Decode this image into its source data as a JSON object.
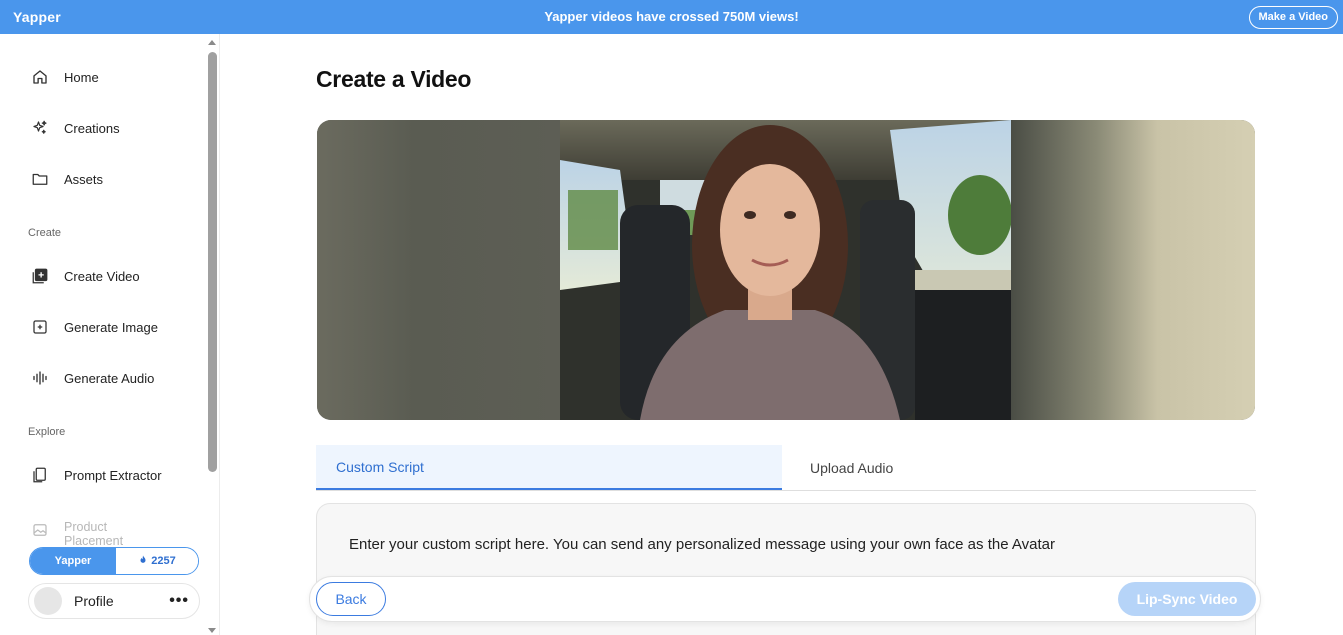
{
  "topbar": {
    "brand": "Yapper",
    "announcement": "Yapper videos have crossed 750M views!",
    "make_button": "Make a Video"
  },
  "sidebar": {
    "items": [
      {
        "label": "Home",
        "icon": "home-icon"
      },
      {
        "label": "Creations",
        "icon": "sparkles-icon"
      },
      {
        "label": "Assets",
        "icon": "folder-icon"
      }
    ],
    "create_label": "Create",
    "create_items": [
      {
        "label": "Create Video",
        "icon": "add-video-icon"
      },
      {
        "label": "Generate Image",
        "icon": "image-plus-icon"
      },
      {
        "label": "Generate Audio",
        "icon": "waveform-icon"
      }
    ],
    "explore_label": "Explore",
    "explore_items": [
      {
        "label": "Prompt Extractor",
        "icon": "copy-doc-icon"
      },
      {
        "label": "Product Placement",
        "icon": "image-icon"
      }
    ],
    "plan_label": "Yapper",
    "credits": "2257",
    "profile_name": "Profile",
    "profile_more": "•••"
  },
  "main": {
    "title": "Create a Video",
    "tabs": [
      {
        "label": "Custom Script",
        "active": true
      },
      {
        "label": "Upload Audio",
        "active": false
      }
    ],
    "script_text": "Enter your custom script here. You can send any personalized message using your own face as the Avatar",
    "back_button": "Back",
    "lipsync_button": "Lip-Sync Video"
  },
  "colors": {
    "accent": "#4a96ec",
    "tab_active_bg": "#eef5fe",
    "tab_active_text": "#2f6fd0",
    "disabled_button": "#b6d4f8"
  }
}
